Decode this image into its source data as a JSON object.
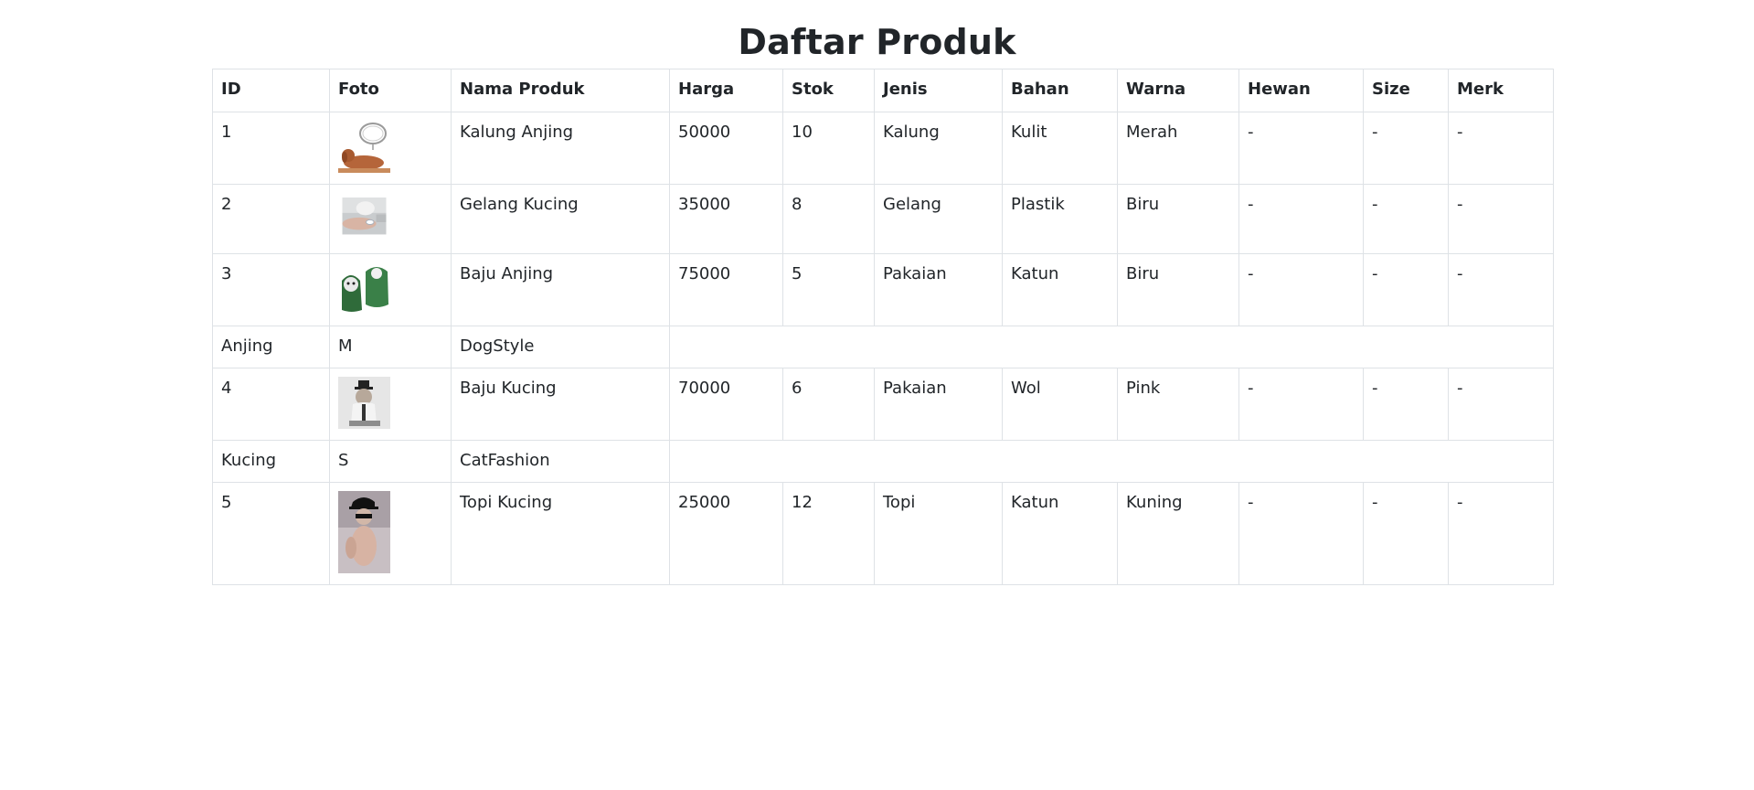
{
  "page": {
    "title": "Daftar Produk"
  },
  "table": {
    "headers": [
      "ID",
      "Foto",
      "Nama Produk",
      "Harga",
      "Stok",
      "Jenis",
      "Bahan",
      "Warna",
      "Hewan",
      "Size",
      "Merk"
    ],
    "rows": [
      {
        "id": "1",
        "foto": "dog-collar-photo",
        "nama": "Kalung Anjing",
        "harga": "50000",
        "stok": "10",
        "jenis": "Kalung",
        "bahan": "Kulit",
        "warna": "Merah",
        "hewan": "-",
        "size": "-",
        "merk": "-"
      },
      {
        "id": "2",
        "foto": "cat-bracelet-photo",
        "nama": "Gelang Kucing",
        "harga": "35000",
        "stok": "8",
        "jenis": "Gelang",
        "bahan": "Plastik",
        "warna": "Biru",
        "hewan": "-",
        "size": "-",
        "merk": "-"
      },
      {
        "id": "3",
        "foto": "dog-clothes-photo",
        "nama": "Baju Anjing",
        "harga": "75000",
        "stok": "5",
        "jenis": "Pakaian",
        "bahan": "Katun",
        "warna": "Biru",
        "hewan": "-",
        "size": "-",
        "merk": "-"
      },
      {
        "id": "4",
        "foto": "cat-clothes-photo",
        "nama": "Baju Kucing",
        "harga": "70000",
        "stok": "6",
        "jenis": "Pakaian",
        "bahan": "Wol",
        "warna": "Pink",
        "hewan": "-",
        "size": "-",
        "merk": "-"
      },
      {
        "id": "5",
        "foto": "cat-hat-photo",
        "nama": "Topi Kucing",
        "harga": "25000",
        "stok": "12",
        "jenis": "Topi",
        "bahan": "Katun",
        "warna": "Kuning",
        "hewan": "-",
        "size": "-",
        "merk": "-"
      }
    ],
    "extra_rows": [
      {
        "hewan": "Anjing",
        "size": "M",
        "merk": "DogStyle"
      },
      {
        "hewan": "Kucing",
        "size": "S",
        "merk": "CatFashion"
      }
    ]
  },
  "colors": {
    "border": "#dee2e6",
    "text": "#212529"
  }
}
